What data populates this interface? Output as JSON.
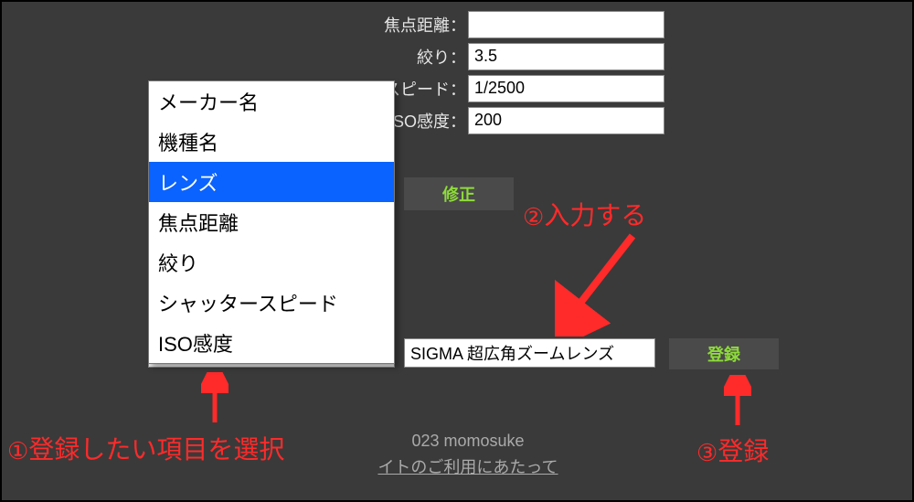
{
  "form": {
    "focal_length": {
      "label": "焦点距離：",
      "value": ""
    },
    "aperture": {
      "label": "絞り：",
      "value": "3.5"
    },
    "shutter": {
      "label": "シャッタースピード：",
      "value": "1/2500"
    },
    "iso": {
      "label": "ISO感度：",
      "value": "200"
    }
  },
  "modify_label": "修正",
  "dropdown": {
    "items": [
      "メーカー名",
      "機種名",
      "レンズ",
      "焦点距離",
      "絞り",
      "シャッタースピード",
      "ISO感度"
    ],
    "selected_index": 2
  },
  "select": {
    "value": "レンズ"
  },
  "value_input": {
    "value": "SIGMA 超広角ズームレンズ"
  },
  "register_label": "登録",
  "annotations": {
    "step1": {
      "num": "①",
      "text": "登録したい項目を選択"
    },
    "step2": {
      "num": "②",
      "text": "入力する"
    },
    "step3": {
      "num": "③",
      "text": "登録"
    }
  },
  "footer": {
    "copyright": "023 momosuke",
    "terms": "イトのご利用にあたって"
  }
}
